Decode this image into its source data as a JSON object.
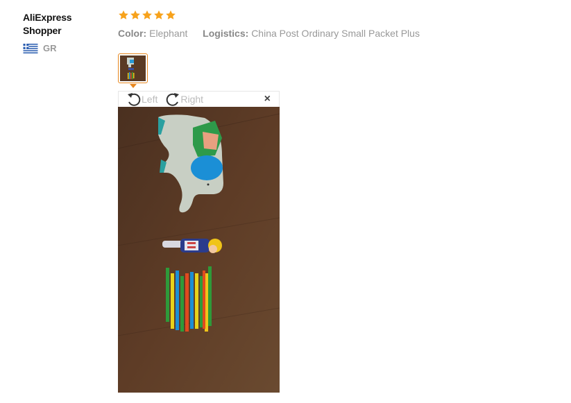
{
  "reviewer": {
    "name": "AliExpress Shopper",
    "country_code": "GR",
    "flag_icon": "greece-flag-icon"
  },
  "review": {
    "rating": 5,
    "rating_max": 5,
    "star_color": "#f7a21b",
    "attributes": [
      {
        "label": "Color:",
        "value": "Elephant"
      },
      {
        "label": "Logistics:",
        "value": "China Post Ordinary Small Packet Plus"
      }
    ]
  },
  "viewer": {
    "rotate_left_label": "Left",
    "rotate_right_label": "Right",
    "close_label": "×",
    "accent_color": "#e8871e"
  }
}
